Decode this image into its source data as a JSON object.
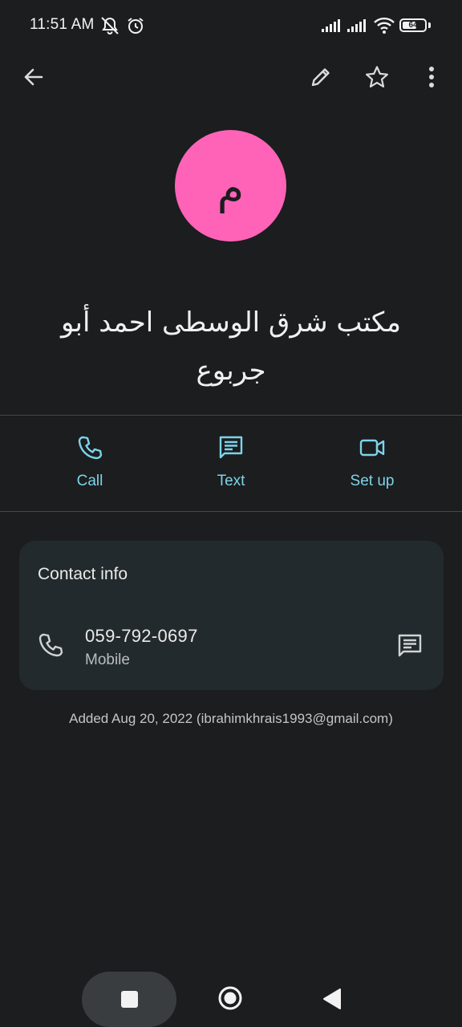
{
  "status_bar": {
    "time": "11:51 AM",
    "battery_percent": "64",
    "battery_level": 0.64,
    "icons": [
      "notifications-off-icon",
      "alarm-icon",
      "signal-icon",
      "signal-icon",
      "wifi-icon",
      "battery-icon"
    ]
  },
  "toolbar": {
    "back_icon": "arrow-back-icon",
    "edit_icon": "pencil-icon",
    "favorite_icon": "star-outline-icon",
    "more_icon": "more-vert-icon"
  },
  "contact": {
    "avatar_letter": "م",
    "avatar_color": "#ff63b8",
    "name": "مكتب شرق الوسطى احمد أبو جربوع"
  },
  "actions": [
    {
      "label": "Call",
      "icon": "phone-icon"
    },
    {
      "label": "Text",
      "icon": "message-icon"
    },
    {
      "label": "Set up",
      "icon": "video-camera-icon"
    }
  ],
  "accent_color": "#7ed3ea",
  "contact_info": {
    "title": "Contact info",
    "phone": {
      "number": "059-792-0697",
      "type": "Mobile"
    }
  },
  "added_text": "Added Aug 20, 2022 (ibrahimkhrais1993@gmail.com)",
  "nav": {
    "recents_icon": "square-icon",
    "home_icon": "circle-icon",
    "back_icon": "triangle-back-icon"
  }
}
